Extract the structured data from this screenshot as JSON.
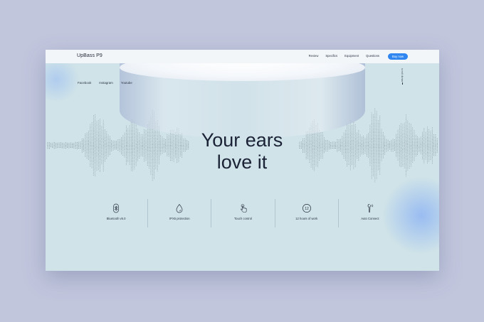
{
  "nav": {
    "brand": "UpBass P9",
    "links": [
      "Review",
      "Specifics",
      "Equipment",
      "Questions"
    ],
    "buy_label": "Buy now"
  },
  "social": [
    "Facebook",
    "Instagram",
    "Youtube"
  ],
  "scroll_hint": "scroll down",
  "hero": {
    "headline_line1": "Your ears",
    "headline_line2": "love it"
  },
  "features": [
    {
      "icon": "bluetooth-icon",
      "label": "Bluetooth v5.0"
    },
    {
      "icon": "water-drop-icon",
      "label": "IPX5 protection"
    },
    {
      "icon": "touch-hand-icon",
      "label": "Touch control"
    },
    {
      "icon": "hours-12-icon",
      "label": "12 hours of work",
      "badge": "12"
    },
    {
      "icon": "earbud-icon",
      "label": "Auto Connect"
    }
  ],
  "colors": {
    "accent": "#2f86f0",
    "background": "#c1c6dd",
    "page": "#cfe3e8",
    "text": "#1b2236"
  }
}
